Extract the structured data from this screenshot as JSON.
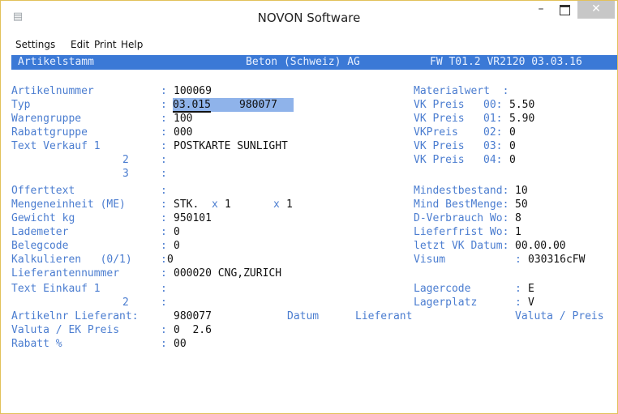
{
  "window": {
    "title": "NOVON Software",
    "icon": "app-icon",
    "minimize": "–",
    "close": "✕"
  },
  "menu": [
    "Settings",
    "Edit",
    "Print",
    "Help"
  ],
  "status": {
    "left": "Artikelstamm",
    "center": "Beton (Schweiz) AG",
    "right": "FW T01.2 VR2120 03.03.16"
  },
  "left": {
    "artikelnummer": {
      "label": "Artikelnummer",
      "value": "100069"
    },
    "typ": {
      "label": "Typ",
      "value1": "03.015",
      "value2": "980077"
    },
    "warengruppe": {
      "label": "Warengruppe",
      "value": "100"
    },
    "rabattgruppe": {
      "label": "Rabattgruppe",
      "value": "000"
    },
    "text_verkauf": {
      "label": "Text Verkauf 1",
      "value": "POSTKARTE SUNLIGHT",
      "line2": "2",
      "line3": "3"
    },
    "offerttext": {
      "label": "Offerttext"
    },
    "mengeneinheit": {
      "label": "Mengeneinheit (ME)",
      "value": "STK.",
      "x1": "x",
      "v1": "1",
      "x2": "x",
      "v2": "1"
    },
    "gewicht": {
      "label": "Gewicht kg",
      "value": "950101"
    },
    "lademeter": {
      "label": "Lademeter",
      "value": "0"
    },
    "belegcode": {
      "label": "Belegcode",
      "value": "0"
    },
    "kalkulieren": {
      "label": "Kalkulieren   (0/1)",
      "value": "0"
    },
    "lieferantennummer": {
      "label": "Lieferantennummer",
      "value": "000020 CNG,ZURICH"
    },
    "text_einkauf": {
      "label": "Text Einkauf 1",
      "line2": "2"
    },
    "artikelnr_lieferant": {
      "label": "Artikelnr Lieferant:",
      "value": "980077"
    },
    "valuta_ek": {
      "label": "Valuta / EK Preis",
      "value": "0  2.6"
    },
    "rabatt": {
      "label": "Rabatt %",
      "value": "00"
    }
  },
  "right": {
    "materialwert": {
      "label": "Materialwert  :"
    },
    "vk_preis": [
      {
        "label": "VK Preis",
        "code": "00:",
        "value": "5.50"
      },
      {
        "label": "VK Preis",
        "code": "01:",
        "value": "5.90"
      },
      {
        "label": "VKPreis",
        "code": "02:",
        "value": "0"
      },
      {
        "label": "VK Preis",
        "code": "03:",
        "value": "0"
      },
      {
        "label": "VK Preis",
        "code": "04:",
        "value": "0"
      }
    ],
    "mindestbestand": {
      "label": "Mindestbestand:",
      "value": "10"
    },
    "mind_bestmenge": {
      "label": "Mind BestMenge:",
      "value": "50"
    },
    "d_verbrauch": {
      "label": "D-Verbrauch Wo:",
      "value": "8"
    },
    "lieferfrist": {
      "label": "Lieferfrist Wo:",
      "value": "1"
    },
    "letzt_vk": {
      "label": "letzt VK Datum:",
      "value": "00.00.00"
    },
    "visum": {
      "label": "Visum",
      "value": "030316cFW"
    },
    "lagercode": {
      "label": "Lagercode",
      "value": "E"
    },
    "lagerplatz": {
      "label": "Lagerplatz",
      "value": "V"
    }
  },
  "table_headers": {
    "datum": "Datum",
    "lieferant": "Lieferant",
    "valuta_preis": "Valuta / Preis"
  }
}
